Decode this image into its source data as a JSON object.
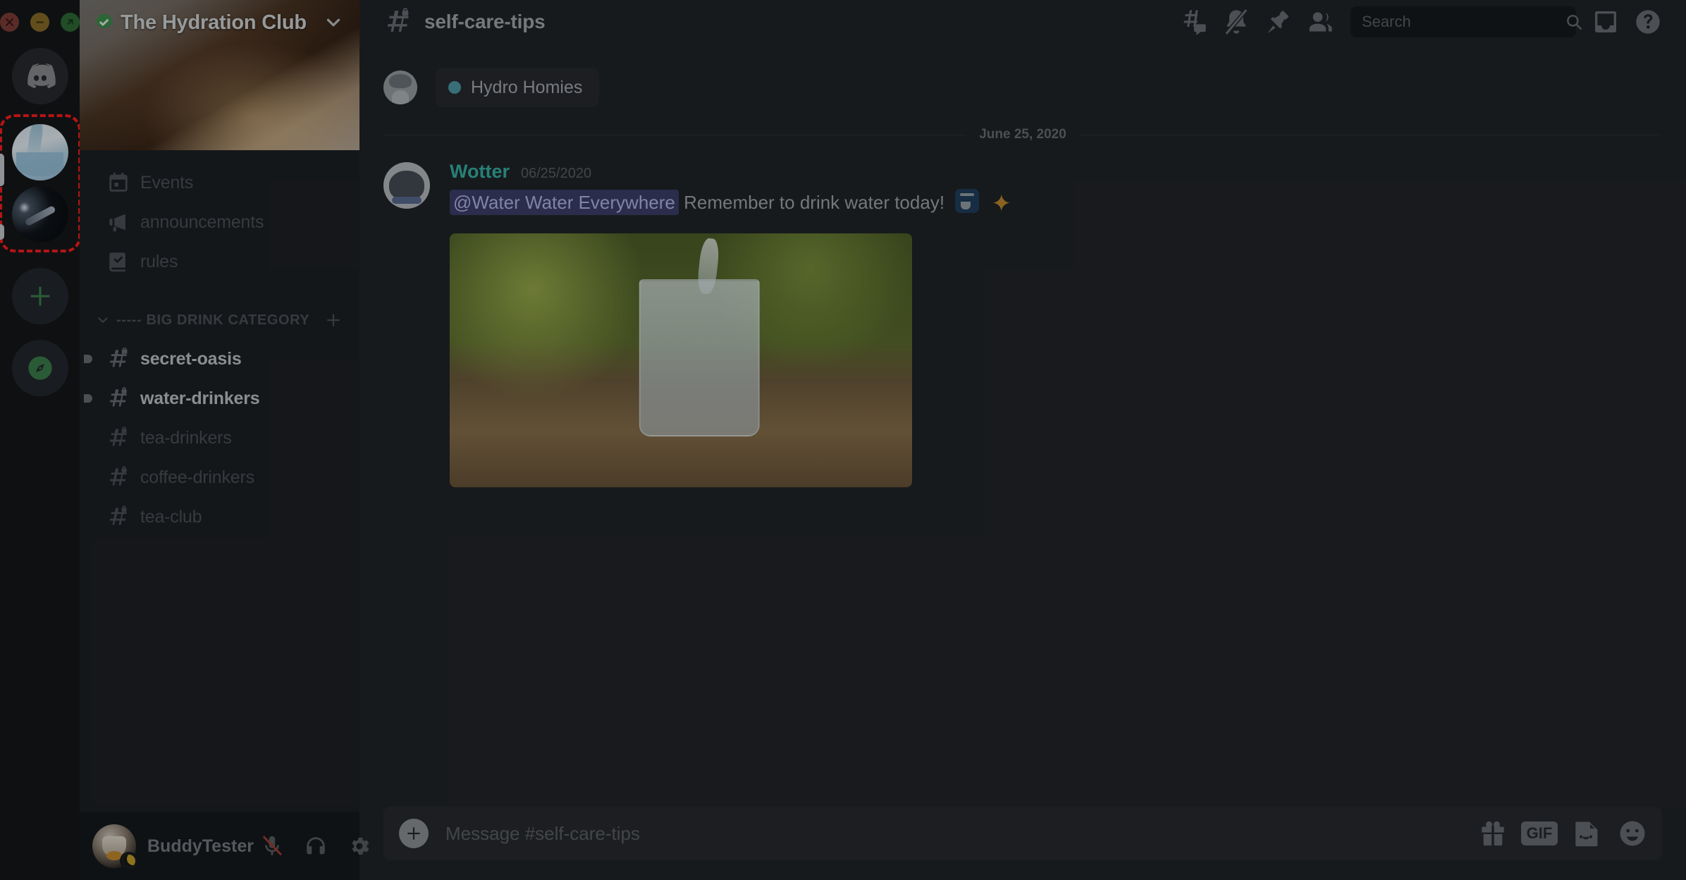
{
  "window": {
    "traffic_lights": [
      {
        "name": "close",
        "color": "#7e3b36"
      },
      {
        "name": "minimize",
        "color": "#8a6a24"
      },
      {
        "name": "maximize",
        "color": "#2d6b33"
      }
    ]
  },
  "guild_rail": {
    "home_label": "Discord Home",
    "servers": [
      {
        "name": "The Hydration Club",
        "thumb": "water-pour",
        "has_unread": true
      },
      {
        "name": "Mic Server",
        "thumb": "microphone",
        "has_unread": true
      }
    ],
    "add_server_label": "Add a Server",
    "explore_label": "Explore Public Servers",
    "highlight_color": "#ff1a1a"
  },
  "server": {
    "name": "The Hydration Club",
    "verified": true,
    "banner_alt": "tea being poured into a cup"
  },
  "channels": {
    "top_items": [
      {
        "label": "Events",
        "icon": "calendar-icon",
        "unread": false,
        "locked": false
      },
      {
        "label": "announcements",
        "icon": "megaphone-icon",
        "unread": false,
        "locked": false
      },
      {
        "label": "rules",
        "icon": "rulebook-icon",
        "unread": false,
        "locked": false
      }
    ],
    "category": {
      "label": "----- BIG DRINK CATEGORY",
      "expanded": true,
      "add_channel_label": "Create Channel"
    },
    "items": [
      {
        "label": "secret-oasis",
        "icon": "hash-lock-icon",
        "unread": true,
        "locked": true
      },
      {
        "label": "water-drinkers",
        "icon": "hash-lock-icon",
        "unread": true,
        "locked": true
      },
      {
        "label": "tea-drinkers",
        "icon": "hash-lock-icon",
        "unread": false,
        "locked": true
      },
      {
        "label": "coffee-drinkers",
        "icon": "hash-lock-icon",
        "unread": false,
        "locked": true
      },
      {
        "label": "tea-club",
        "icon": "hash-lock-icon",
        "unread": false,
        "locked": true
      }
    ]
  },
  "user_panel": {
    "username": "BuddyTester",
    "status": "idle",
    "status_color": "#c9a227",
    "actions": [
      {
        "name": "microphone-muted-icon",
        "label": "Unmute",
        "muted": true
      },
      {
        "name": "headphones-icon",
        "label": "Deafen",
        "muted": false
      },
      {
        "name": "gear-icon",
        "label": "User Settings",
        "muted": false
      }
    ]
  },
  "chat_header": {
    "channel_name": "self-care-tips",
    "channel_locked": true,
    "buttons": [
      {
        "name": "threads-icon",
        "label": "Threads"
      },
      {
        "name": "bell-muted-icon",
        "label": "Notification Settings"
      },
      {
        "name": "pin-icon",
        "label": "Pinned Messages"
      },
      {
        "name": "members-icon",
        "label": "Member List"
      },
      {
        "name": "inbox-icon",
        "label": "Inbox"
      },
      {
        "name": "help-icon",
        "label": "Help"
      }
    ]
  },
  "search": {
    "placeholder": "Search",
    "value": ""
  },
  "conversation": {
    "role_tag": {
      "label": "Hydro Homies",
      "dot_color": "#4e9aa8"
    },
    "date_divider": "June 25, 2020",
    "message": {
      "author": "Wotter",
      "author_color": "#36b3a8",
      "timestamp": "06/25/2020",
      "mention": "@Water Water Everywhere",
      "text": "Remember to drink water today!",
      "emojis": [
        "potable-water-emoji",
        "sparkles-emoji"
      ],
      "attachment_alt": "glass of water being poured outdoors"
    }
  },
  "composer": {
    "placeholder": "Message #self-care-tips",
    "value": "",
    "add_label": "Upload a File",
    "actions": [
      {
        "name": "gift-icon",
        "label": "Gift Nitro"
      },
      {
        "name": "gif-icon",
        "label": "GIF"
      },
      {
        "name": "sticker-icon",
        "label": "Sticker"
      },
      {
        "name": "emoji-icon",
        "label": "Emoji"
      }
    ]
  }
}
